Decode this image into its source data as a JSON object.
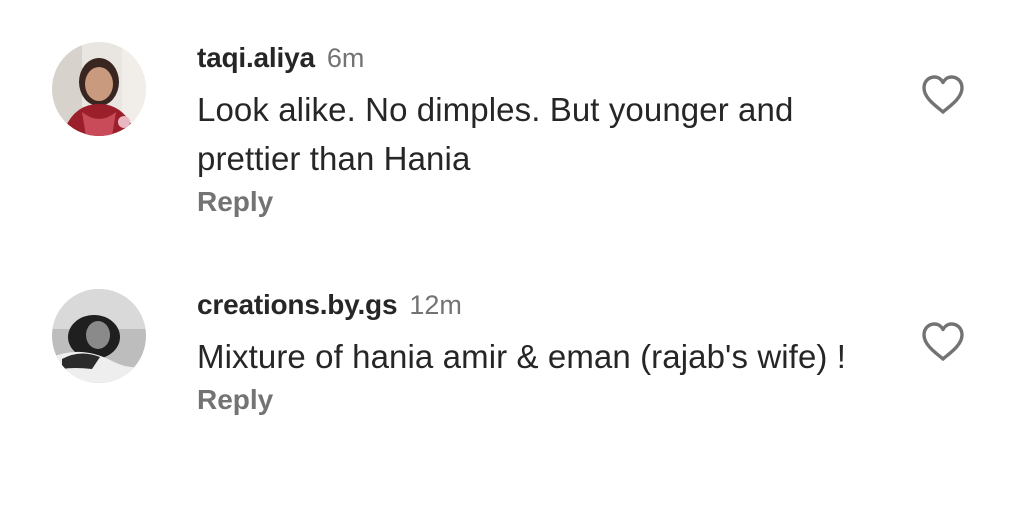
{
  "comments": [
    {
      "username": "taqi.aliya",
      "time": "6m",
      "text": "Look alike. No dimples. But younger and prettier than Hania",
      "reply_label": "Reply",
      "avatar_icon": "user-avatar-photo",
      "like_icon": "heart-outline-icon"
    },
    {
      "username": "creations.by.gs",
      "time": "12m",
      "text": "Mixture of hania amir & eman (rajab's wife) !",
      "reply_label": "Reply",
      "avatar_icon": "user-avatar-photo",
      "like_icon": "heart-outline-icon"
    }
  ],
  "colors": {
    "primary_text": "#262626",
    "secondary_text": "#737373",
    "background": "#ffffff"
  }
}
